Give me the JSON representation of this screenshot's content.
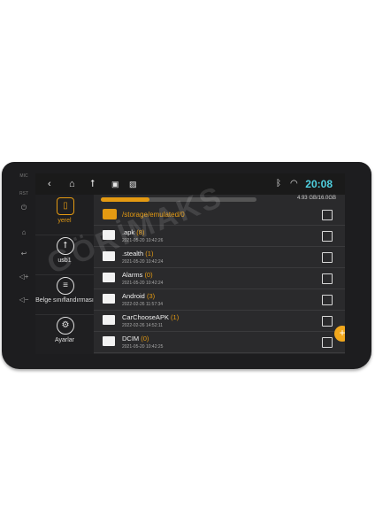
{
  "device": {
    "side_buttons": [
      "MIC",
      "RST",
      "⏻",
      "⌂",
      "↩",
      "◁+",
      "◁−"
    ]
  },
  "statusbar": {
    "time": "20:08",
    "icons": [
      "back-icon",
      "home-icon",
      "usb-icon",
      "image-icon",
      "gallery-icon",
      "bluetooth-icon",
      "wifi-icon"
    ]
  },
  "sidebar": {
    "items": [
      {
        "label": "yerel",
        "icon": "phone-storage-icon"
      },
      {
        "label": "usb1",
        "icon": "usb-icon"
      },
      {
        "label": "Belge sınıflandırması",
        "icon": "list-icon"
      },
      {
        "label": "Ayarlar",
        "icon": "gear-icon"
      }
    ]
  },
  "storage": {
    "used_fraction": 0.31,
    "text": "4.93 GB/16.0GB"
  },
  "path": "/storage/emulated/0",
  "files": [
    {
      "name": ".apk",
      "count": "(8)",
      "date": "2021-05-20 10:42:26"
    },
    {
      "name": ".stealth",
      "count": "(1)",
      "date": "2021-05-20 10:42:24"
    },
    {
      "name": "Alarms",
      "count": "(0)",
      "date": "2021-05-20 10:42:24"
    },
    {
      "name": "Android",
      "count": "(3)",
      "date": "2022-02-26 11:57:34"
    },
    {
      "name": "CarChooseAPK",
      "count": "(1)",
      "date": "2022-02-26 14:52:11"
    },
    {
      "name": "DCIM",
      "count": "(0)",
      "date": "2021-05-20 10:42:25"
    }
  ],
  "fab": "+",
  "watermark": "GÖRİMAKS",
  "colors": {
    "accent": "#e49a12",
    "time": "#4fd0e0"
  }
}
